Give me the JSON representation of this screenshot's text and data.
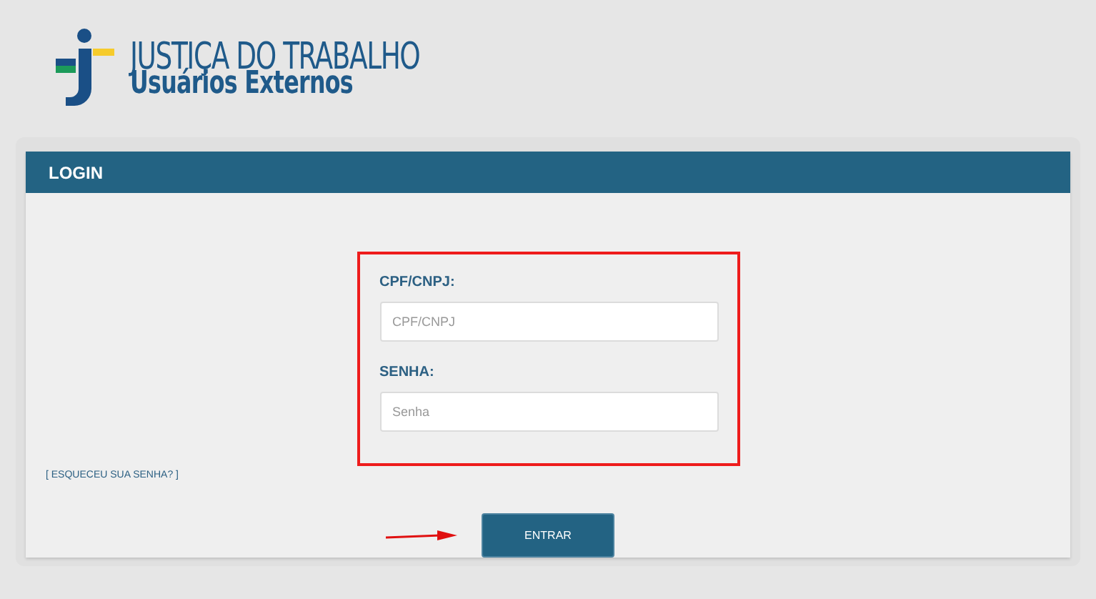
{
  "logo": {
    "title": "JUSTIÇA DO TRABALHO",
    "subtitle": "Usuários Externos"
  },
  "panel": {
    "title": "LOGIN"
  },
  "form": {
    "highlighted": true,
    "fields": [
      {
        "label": "CPF/CNPJ:",
        "placeholder": "CPF/CNPJ"
      },
      {
        "label": "SENHA:",
        "placeholder": "Senha"
      }
    ],
    "forgot_link": "[ ESQUECEU SUA SENHA? ]",
    "submit": "ENTRAR",
    "pointer_arrow": true
  }
}
